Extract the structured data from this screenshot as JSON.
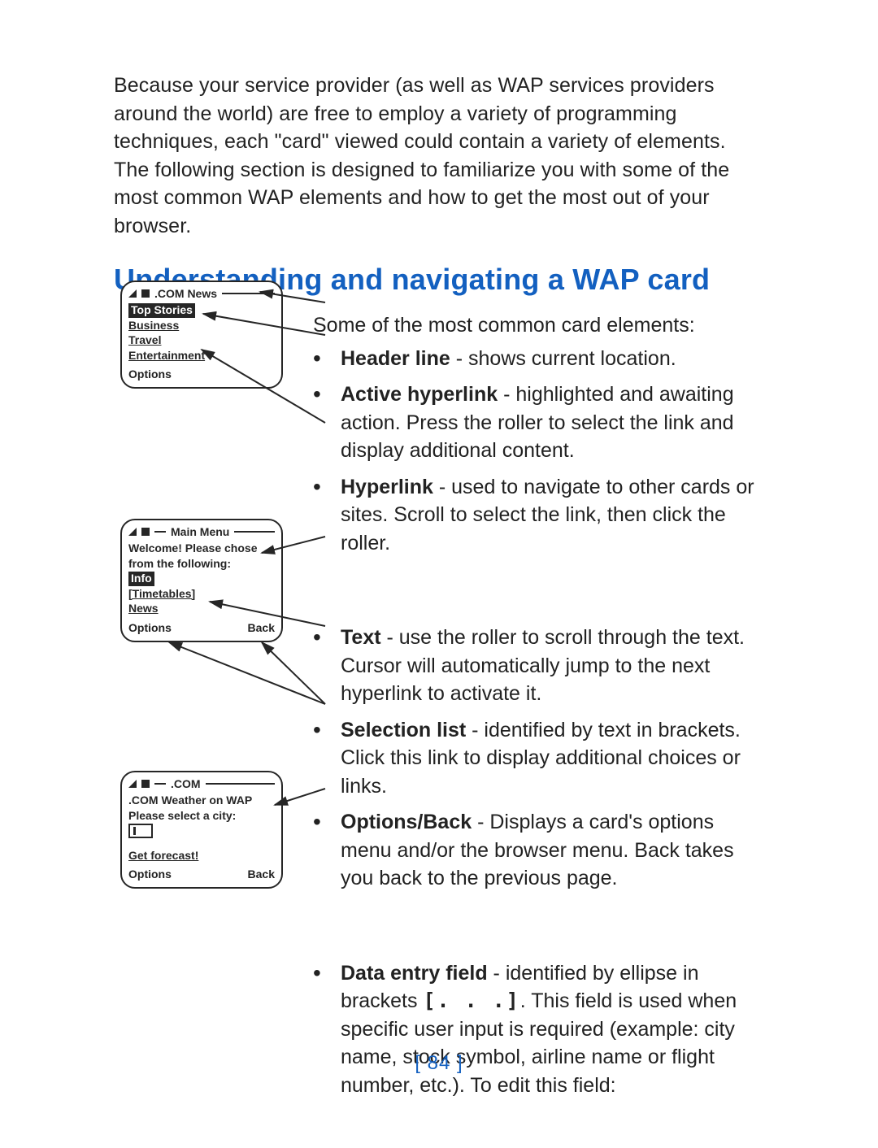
{
  "intro": "Because your service provider (as well as WAP services providers around the world) are free to employ a variety of programming techniques, each \"card\" viewed could contain a variety of elements. The following section is designed to familiarize you with some of the most common WAP elements and how to get the most out of your browser.",
  "heading": "Understanding and navigating a WAP card",
  "lead": "Some of the most common card elements:",
  "bullets1": [
    {
      "term": "Header line",
      "rest": " - shows current location."
    },
    {
      "term": "Active hyperlink",
      "rest": " - highlighted and awaiting action. Press the roller to select the link and display additional content."
    },
    {
      "term": "Hyperlink",
      "rest": " - used to navigate to other cards or sites. Scroll to select the link, then click the roller."
    }
  ],
  "bullets2": [
    {
      "term": "Text",
      "rest": " - use the roller to scroll through the text. Cursor will automatically jump to the next hyperlink to activate it."
    },
    {
      "term": "Selection list",
      "rest": " - identified by text in brackets. Click this link to display additional choices or links."
    },
    {
      "term": "Options/Back",
      "rest": " - Displays a card's options menu and/or the browser menu. Back takes you back to the previous page."
    }
  ],
  "bullets3": [
    {
      "term": "Data entry field",
      "rest_a": " - identified by ellipse in brackets ",
      "code": "[. . .]",
      "rest_b": ". This field is used when specific user input is required (example: city name, stock symbol, airline name or flight number, etc.). To edit this field:"
    }
  ],
  "page_number": "[ 84 ]",
  "screen1": {
    "title": ".COM News",
    "items": [
      "Top Stories",
      "Business",
      "Travel",
      "Entertainment"
    ],
    "soft_left": "Options"
  },
  "screen2": {
    "title": "Main Menu",
    "body_a": "Welcome! Please chose",
    "body_b": "from the following:",
    "item_sel": "Info",
    "item_br": "[Timetables]",
    "item_plain": "News",
    "soft_left": "Options",
    "soft_right": "Back"
  },
  "screen3": {
    "title": ".COM",
    "line_a": ".COM Weather on WAP",
    "line_b": "Please select a city:",
    "link": "Get forecast!",
    "soft_left": "Options",
    "soft_right": "Back"
  }
}
